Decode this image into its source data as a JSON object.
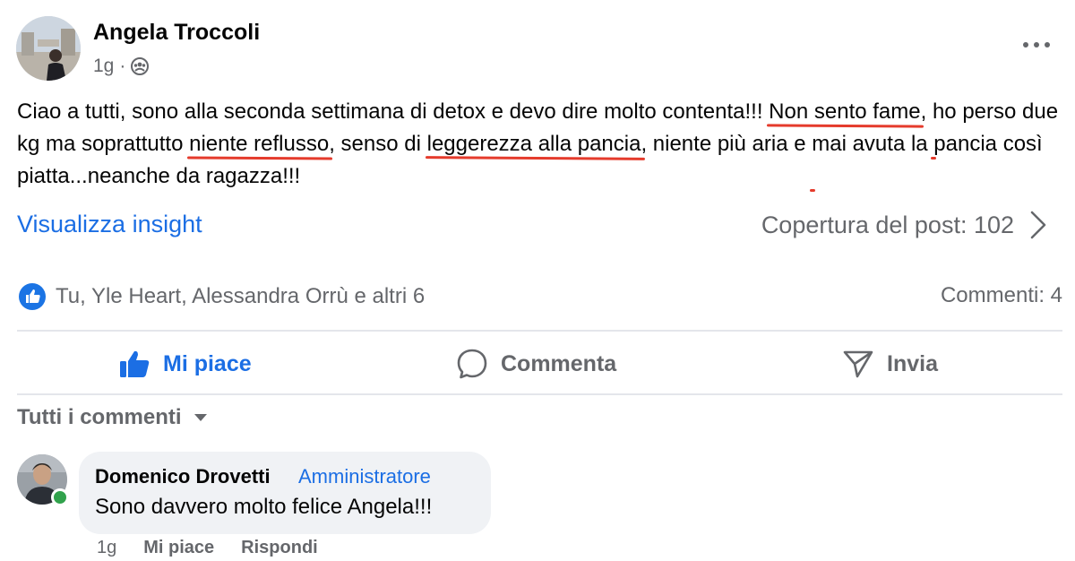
{
  "post": {
    "author": "Angela Troccoli",
    "time": "1g",
    "separator": "·",
    "privacy_icon": "group-icon",
    "more_icon": "more-horizontal-icon",
    "body": {
      "p1": "Ciao a tutti, sono alla seconda settimana di detox e devo dire molto contenta!!! ",
      "u1": "Non sento fame",
      "p2": ", ",
      "u2": "ho perso due kg",
      "p3": " ma soprattutto ",
      "u3": "niente reflusso",
      "p4": ", senso di ",
      "u4": "leggerezza alla pancia",
      "p5": ", niente più aria e ",
      "u5": "mai avuta la pancia così piatta",
      "p6": "...neanche da ragazza!!!"
    },
    "insights_link": "Visualizza insight",
    "reach_label": "Copertura del post: 102",
    "reactions_text": "Tu, Yle Heart, Alessandra Orrù e altri 6",
    "comments_count": "Commenti: 4",
    "underline_color": "#e53b2c",
    "accent_color": "#1b6ee4"
  },
  "actions": {
    "like": "Mi piace",
    "comment": "Commenta",
    "send": "Invia"
  },
  "comments_filter": "Tutti i commenti",
  "comment": {
    "author": "Domenico Drovetti",
    "role": "Amministratore",
    "text": "Sono davvero molto felice Angela!!!",
    "time": "1g",
    "like": "Mi piace",
    "reply": "Rispondi",
    "online": true
  }
}
